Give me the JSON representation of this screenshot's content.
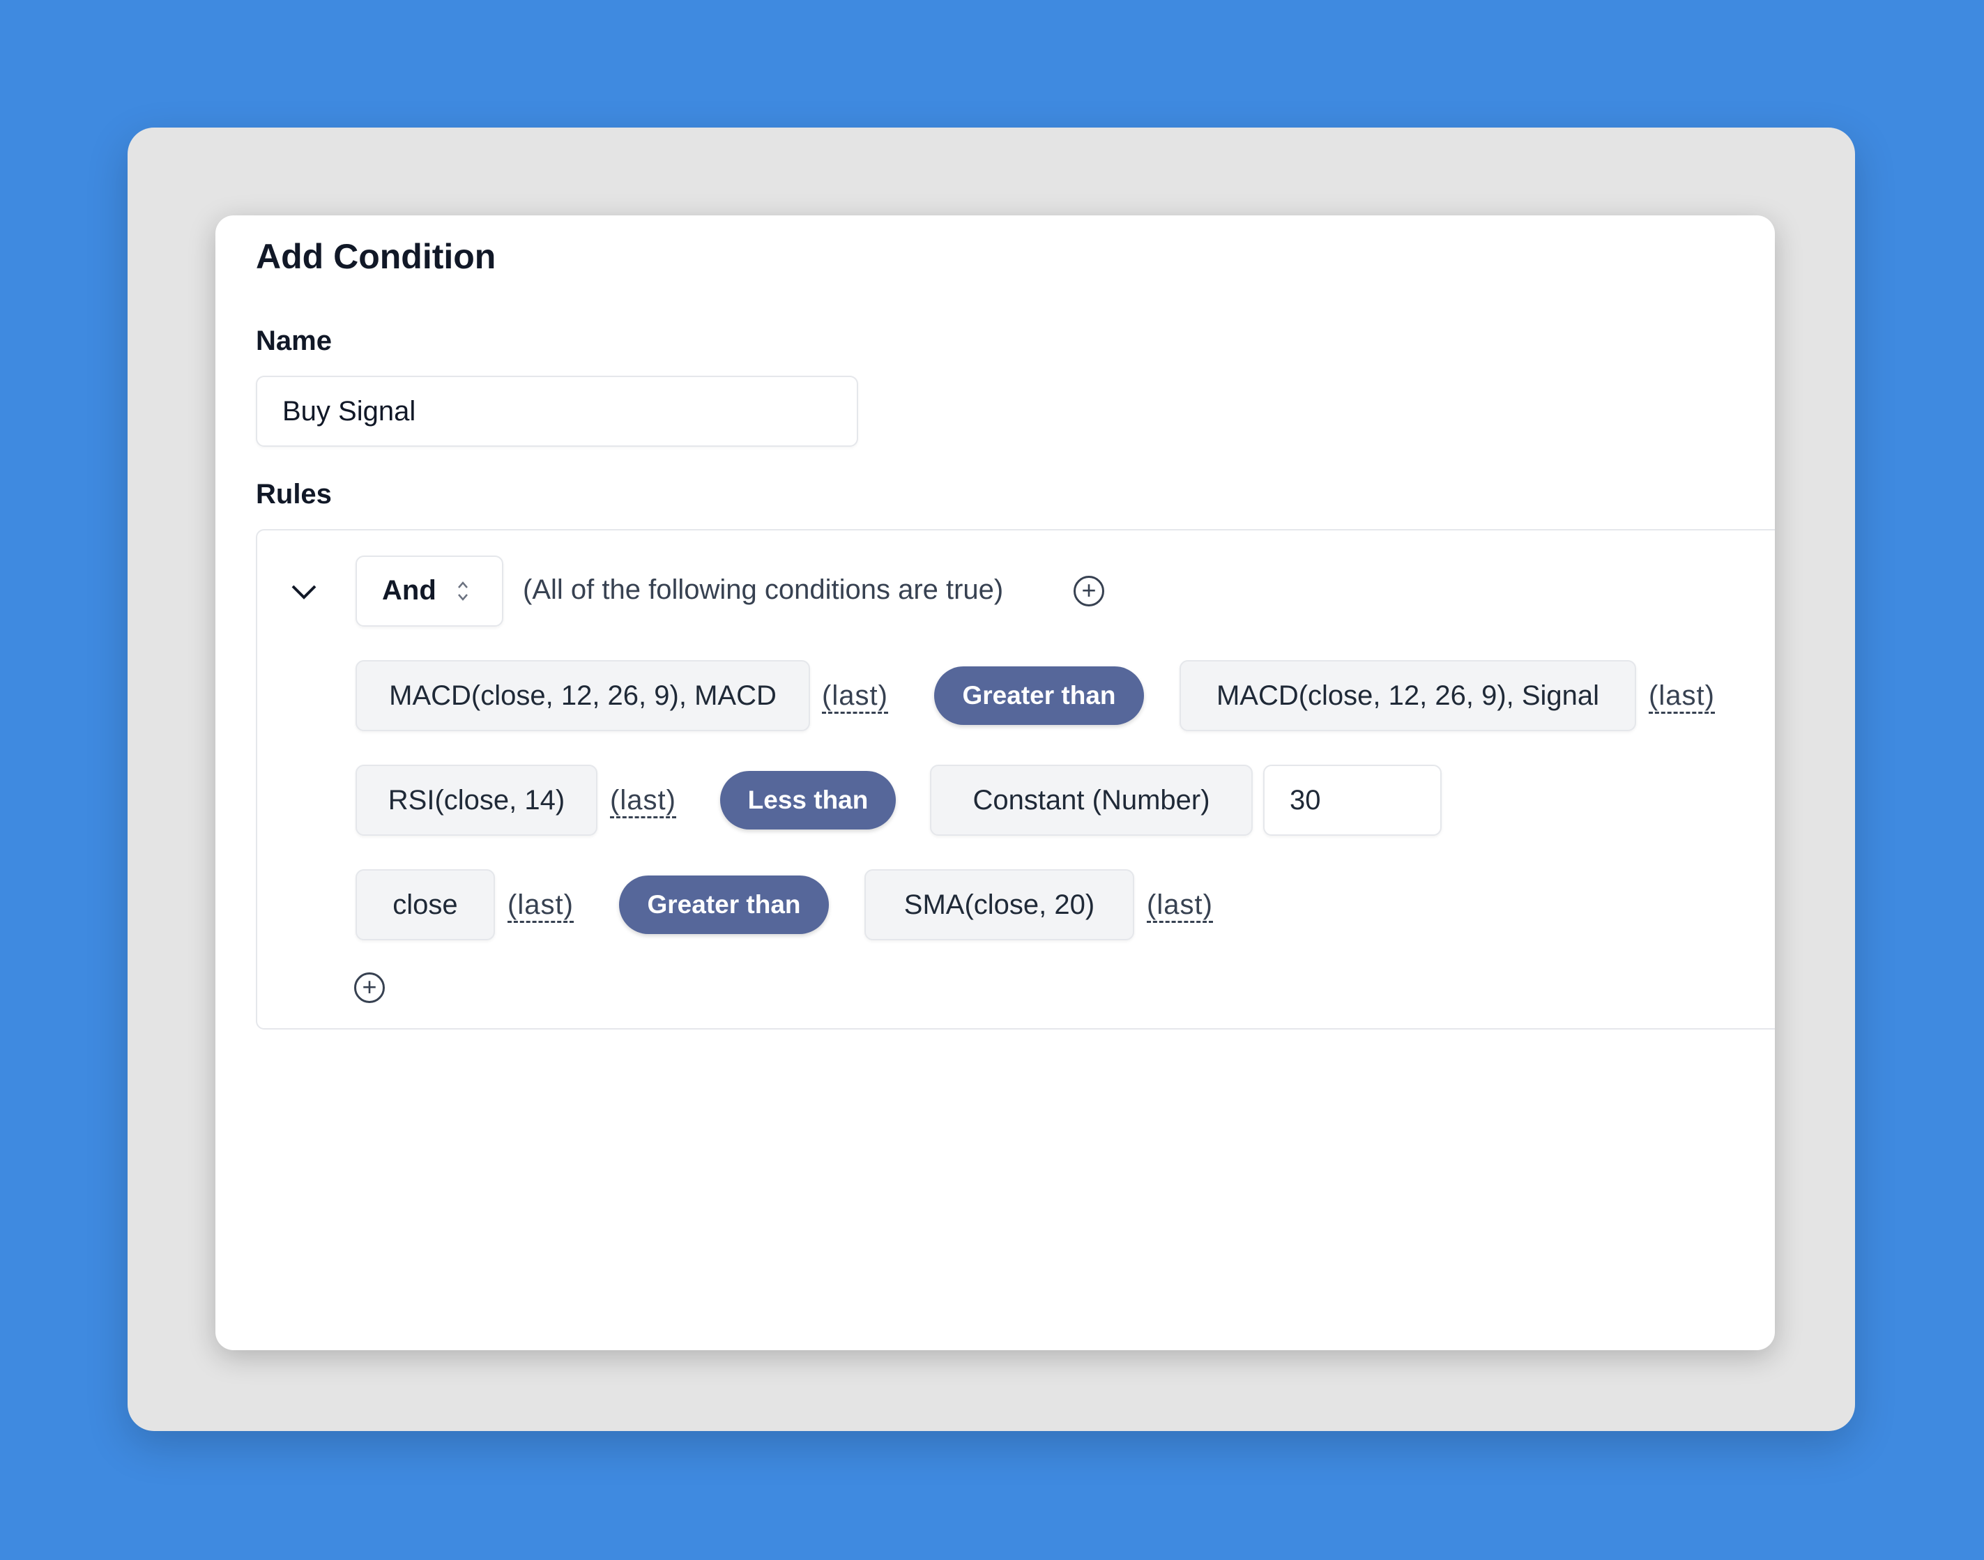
{
  "dialog": {
    "title": "Add Condition",
    "name_label": "Name",
    "name_value": "Buy Signal",
    "rules_label": "Rules"
  },
  "group": {
    "operator": "And",
    "description": "(All of the following conditions are true)"
  },
  "rules": [
    {
      "left": "MACD(close, 12, 26, 9), MACD",
      "left_mode": "(last)",
      "comparator": "Greater than",
      "right": "MACD(close, 12, 26, 9), Signal",
      "right_mode": "(last)"
    },
    {
      "left": "RSI(close, 14)",
      "left_mode": "(last)",
      "comparator": "Less than",
      "right": "Constant (Number)",
      "right_value": "30"
    },
    {
      "left": "close",
      "left_mode": "(last)",
      "comparator": "Greater than",
      "right": "SMA(close, 20)",
      "right_mode": "(last)"
    }
  ],
  "colors": {
    "background": "#3F8AE0",
    "comparator_pill": "#56679A"
  }
}
